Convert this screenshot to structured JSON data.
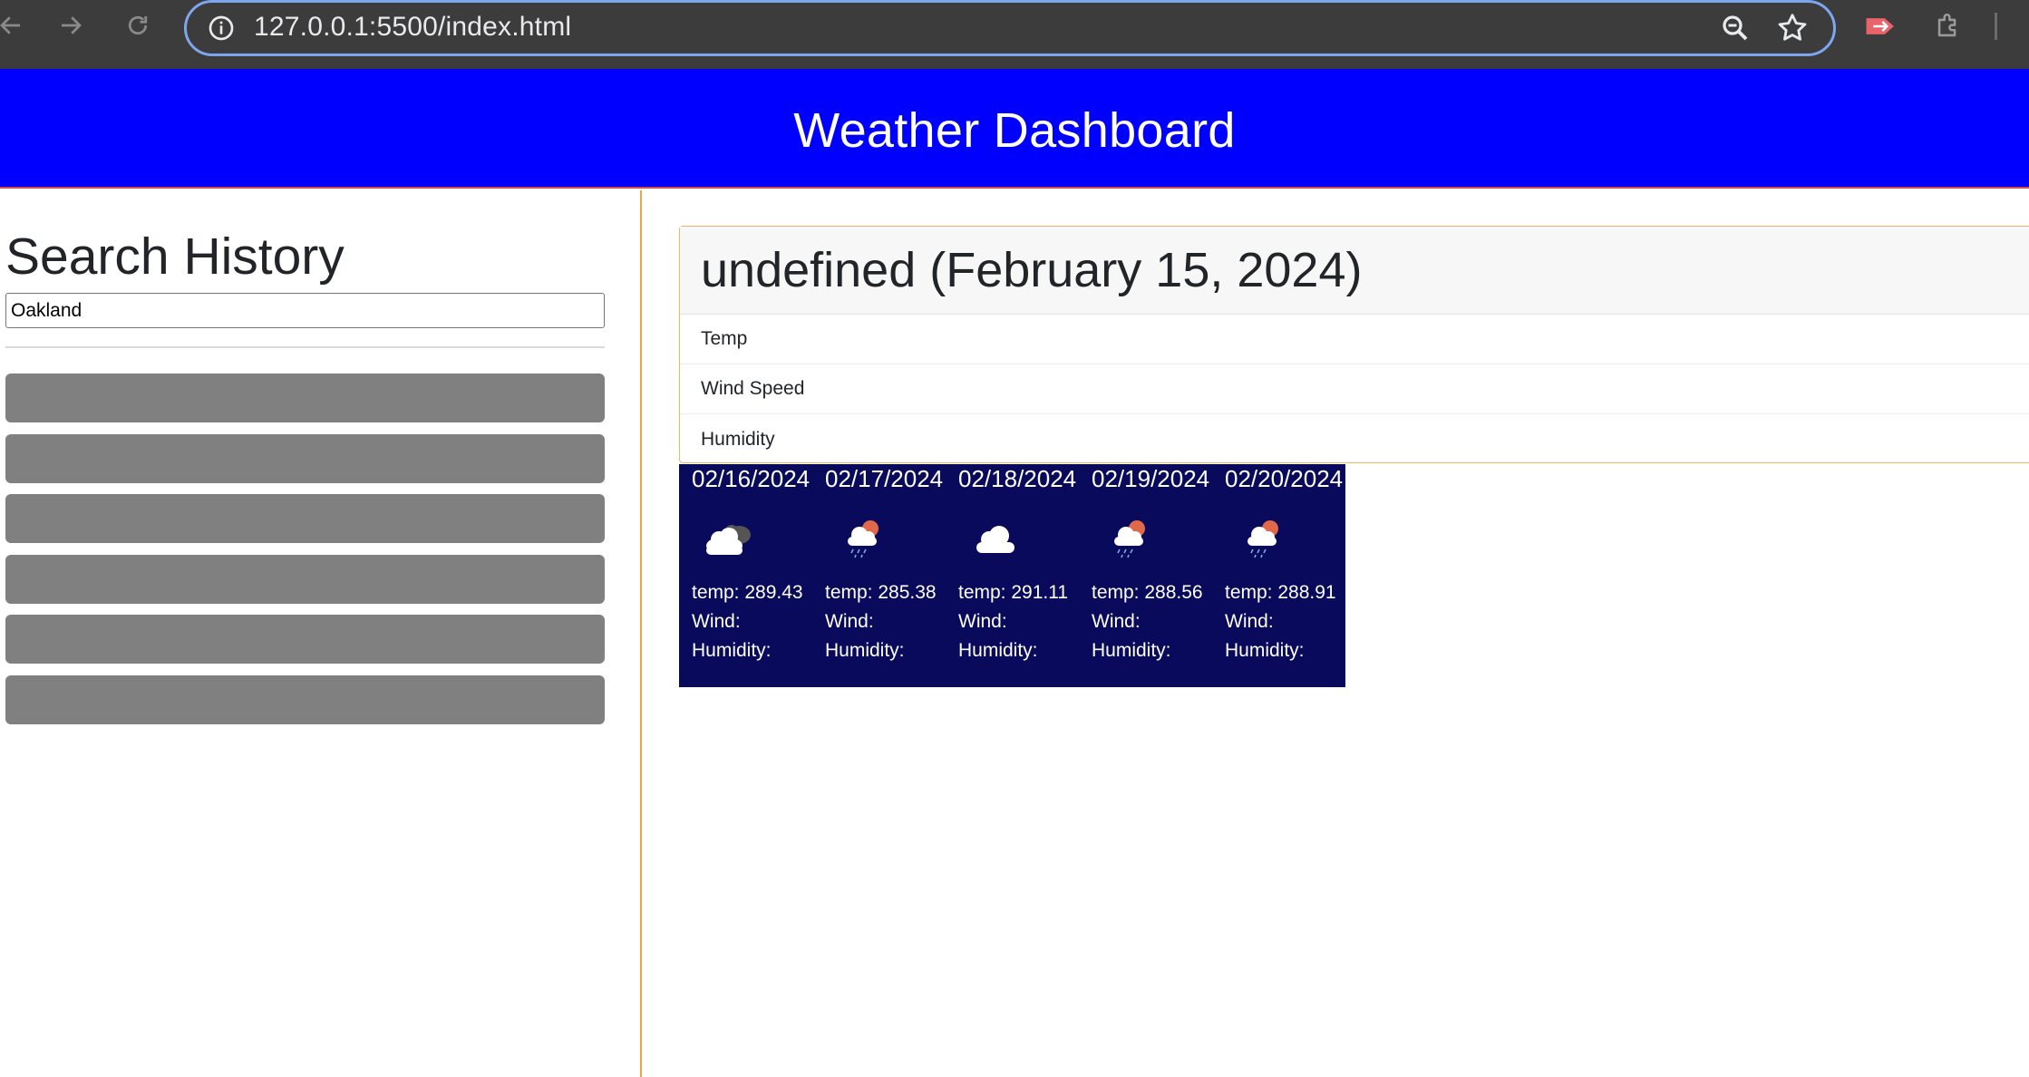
{
  "browser": {
    "url": "127.0.0.1:5500/index.html"
  },
  "header": {
    "title": "Weather Dashboard"
  },
  "sidebar": {
    "heading": "Search History",
    "search_value": "Oakland",
    "history_buttons": [
      "",
      "",
      "",
      "",
      "",
      ""
    ]
  },
  "current": {
    "title": "undefined (February 15, 2024)",
    "rows": [
      "Temp",
      "Wind Speed",
      "Humidity"
    ]
  },
  "forecast": [
    {
      "date": "02/16/2024",
      "icon": "broken-clouds-icon",
      "temp": "temp: 289.43",
      "wind": "Wind:",
      "humidity": "Humidity:"
    },
    {
      "date": "02/17/2024",
      "icon": "rain-sun-icon",
      "temp": "temp: 285.38",
      "wind": "Wind:",
      "humidity": "Humidity:"
    },
    {
      "date": "02/18/2024",
      "icon": "cloud-icon",
      "temp": "temp: 291.11",
      "wind": "Wind:",
      "humidity": "Humidity:"
    },
    {
      "date": "02/19/2024",
      "icon": "rain-sun-icon",
      "temp": "temp: 288.56",
      "wind": "Wind:",
      "humidity": "Humidity:"
    },
    {
      "date": "02/20/2024",
      "icon": "rain-sun-icon",
      "temp": "temp: 288.91",
      "wind": "Wind:",
      "humidity": "Humidity:"
    }
  ],
  "colors": {
    "header_bg": "#0000ff",
    "forecast_bg": "#0a0a5c",
    "history_button": "#808080",
    "accent_border": "#e9a848"
  }
}
